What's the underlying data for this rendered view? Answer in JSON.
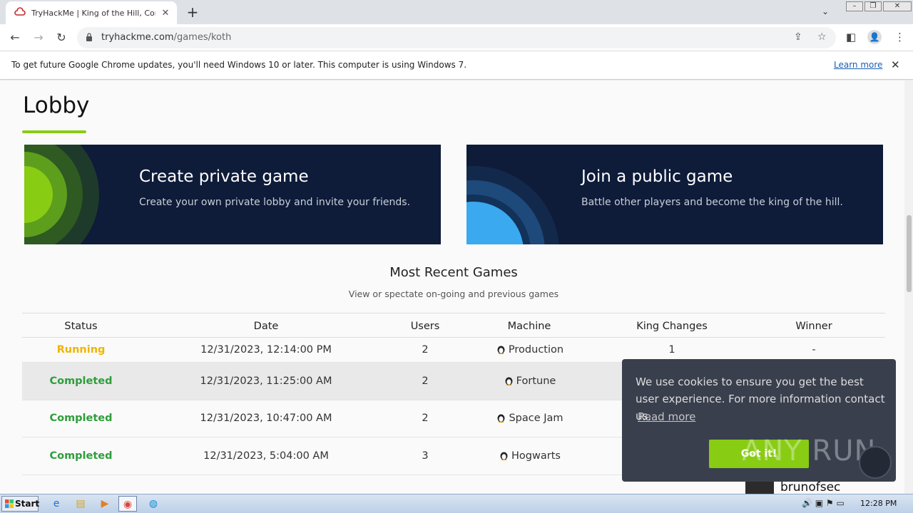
{
  "browser": {
    "tab_title": "TryHackMe | King of the Hill, Compet",
    "url_host": "tryhackme.com",
    "url_path": "/games/koth",
    "infobar_message": "To get future Google Chrome updates, you'll need Windows 10 or later. This computer is using Windows 7.",
    "infobar_link": "Learn more"
  },
  "page": {
    "title": "Lobby",
    "accent_color": "#88cc14",
    "cards": [
      {
        "title": "Create private game",
        "subtitle": "Create your own private lobby and invite your friends."
      },
      {
        "title": "Join a public game",
        "subtitle": "Battle other players and become the king of the hill."
      }
    ],
    "recent_title": "Most Recent Games",
    "recent_subtitle": "View or spectate on-going and previous games",
    "table": {
      "headers": [
        "Status",
        "Date",
        "Users",
        "Machine",
        "King Changes",
        "Winner"
      ],
      "rows": [
        {
          "status": "Running",
          "date": "12/31/2023, 12:14:00 PM",
          "users": "2",
          "machine": "Production",
          "king_changes": "1",
          "winner": "-"
        },
        {
          "status": "Completed",
          "date": "12/31/2023, 11:25:00 AM",
          "users": "2",
          "machine": "Fortune",
          "king_changes": "",
          "winner": ""
        },
        {
          "status": "Completed",
          "date": "12/31/2023, 10:47:00 AM",
          "users": "2",
          "machine": "Space Jam",
          "king_changes": "",
          "winner": ""
        },
        {
          "status": "Completed",
          "date": "12/31/2023, 5:04:00 AM",
          "users": "3",
          "machine": "Hogwarts",
          "king_changes": "",
          "winner": ""
        }
      ]
    },
    "peek_winner": "brunofsec"
  },
  "cookie": {
    "text": "We use cookies to ensure you get the best user experience. For more information contact us.",
    "read_more": "Read more",
    "button": "Got it!"
  },
  "watermark": "ANY RUN",
  "taskbar": {
    "start": "Start",
    "clock": "12:28 PM"
  }
}
